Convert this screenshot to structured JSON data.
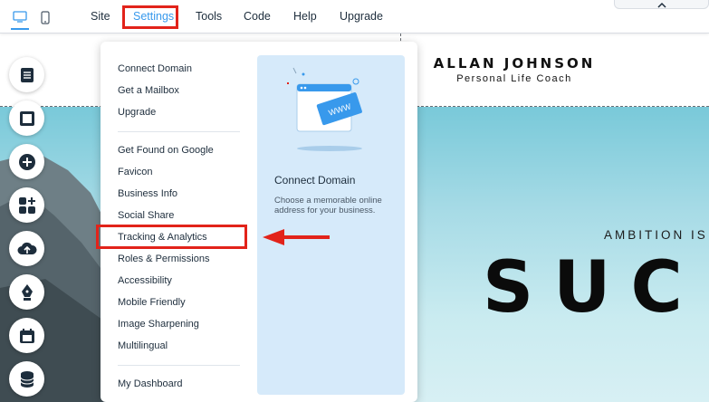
{
  "topbar": {
    "menu": [
      "Site",
      "Settings",
      "Tools",
      "Code",
      "Help",
      "Upgrade"
    ],
    "active": "Settings",
    "icons": [
      "desktop-icon",
      "mobile-icon",
      "chevron-up-icon"
    ]
  },
  "site": {
    "brand_name": "ALLAN JOHNSON",
    "brand_subtitle": "Personal Life Coach",
    "tagline": "AMBITION IS T",
    "big_word": "SUC"
  },
  "rail": {
    "icons": [
      "pages-icon",
      "background-icon",
      "add-icon",
      "add-apps-icon",
      "upload-icon",
      "blog-pen-icon",
      "bookings-calendar-icon",
      "database-icon"
    ]
  },
  "settings_menu": {
    "group1": [
      "Connect Domain",
      "Get a Mailbox",
      "Upgrade"
    ],
    "group2": [
      "Get Found on Google",
      "Favicon",
      "Business Info",
      "Social Share",
      "Tracking & Analytics",
      "Roles & Permissions",
      "Accessibility",
      "Mobile Friendly",
      "Image Sharpening",
      "Multilingual"
    ],
    "group3": [
      "My Dashboard"
    ],
    "highlighted": "Tracking & Analytics",
    "info": {
      "title": "Connect Domain",
      "description": "Choose a memorable online address for your business.",
      "badge": "WWW"
    }
  },
  "colors": {
    "accent": "#3899ec",
    "highlight_red": "#e2231a",
    "info_panel": "#d6eafa"
  }
}
